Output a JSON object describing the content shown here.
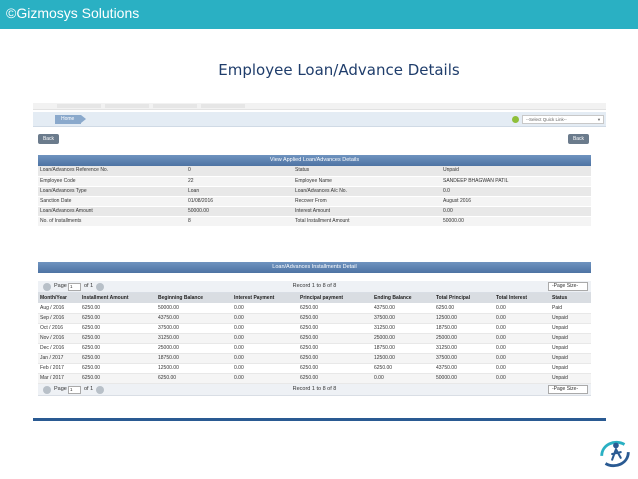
{
  "slide": {
    "brand": "©Gizmosys Solutions",
    "title": "Employee Loan/Advance Details"
  },
  "app": {
    "breadcrumb_home": "Home",
    "quick_link_placeholder": "--Select Quick Link--",
    "back_label": "Back",
    "details_heading": "View Applied Loan/Advances Details",
    "details": [
      [
        "Loan/Advances Reference No.",
        "0",
        "Status",
        "Unpaid"
      ],
      [
        "Employee Code",
        "22",
        "Employee Name",
        "SANDEEP BHAGWAN PATIL"
      ],
      [
        "Loan/Advances Type",
        "Loan",
        "Loan/Advances A/c No.",
        "0.0"
      ],
      [
        "Sanction Date",
        "01/08/2016",
        "Recover From",
        "August 2016"
      ],
      [
        "Loan/Advances Amount",
        "50000.00",
        "Interest Amount",
        "0.00"
      ],
      [
        "No. of Installments",
        "8",
        "Total Installment Amount",
        "50000.00"
      ]
    ],
    "installments_heading": "Loan/Advances Installments Detail",
    "pager": {
      "page_label": "Page",
      "page_value": "1",
      "of_label": "of 1",
      "record_text": "Record 1 to 8 of 8",
      "page_size": "-Page Size-"
    },
    "columns": [
      "Month/Year",
      "Installment Amount",
      "Beginning Balance",
      "Interest Payment",
      "Principal payment",
      "Ending Balance",
      "Total Principal",
      "Total Interest",
      "Status"
    ],
    "rows": [
      [
        "Aug / 2016",
        "6250.00",
        "50000.00",
        "0.00",
        "6250.00",
        "43750.00",
        "6250.00",
        "0.00",
        "Paid"
      ],
      [
        "Sep / 2016",
        "6250.00",
        "43750.00",
        "0.00",
        "6250.00",
        "37500.00",
        "12500.00",
        "0.00",
        "Unpaid"
      ],
      [
        "Oct / 2016",
        "6250.00",
        "37500.00",
        "0.00",
        "6250.00",
        "31250.00",
        "18750.00",
        "0.00",
        "Unpaid"
      ],
      [
        "Nov / 2016",
        "6250.00",
        "31250.00",
        "0.00",
        "6250.00",
        "25000.00",
        "25000.00",
        "0.00",
        "Unpaid"
      ],
      [
        "Dec / 2016",
        "6250.00",
        "25000.00",
        "0.00",
        "6250.00",
        "18750.00",
        "31250.00",
        "0.00",
        "Unpaid"
      ],
      [
        "Jan / 2017",
        "6250.00",
        "18750.00",
        "0.00",
        "6250.00",
        "12500.00",
        "37500.00",
        "0.00",
        "Unpaid"
      ],
      [
        "Feb / 2017",
        "6250.00",
        "12500.00",
        "0.00",
        "6250.00",
        "6250.00",
        "43750.00",
        "0.00",
        "Unpaid"
      ],
      [
        "Mar / 2017",
        "6250.00",
        "6250.00",
        "0.00",
        "6250.00",
        "0.00",
        "50000.00",
        "0.00",
        "Unpaid"
      ]
    ]
  },
  "colors": {
    "topbar": "#2ab0c3",
    "title": "#1f3d6b",
    "panel_header": "#4d73a3"
  }
}
